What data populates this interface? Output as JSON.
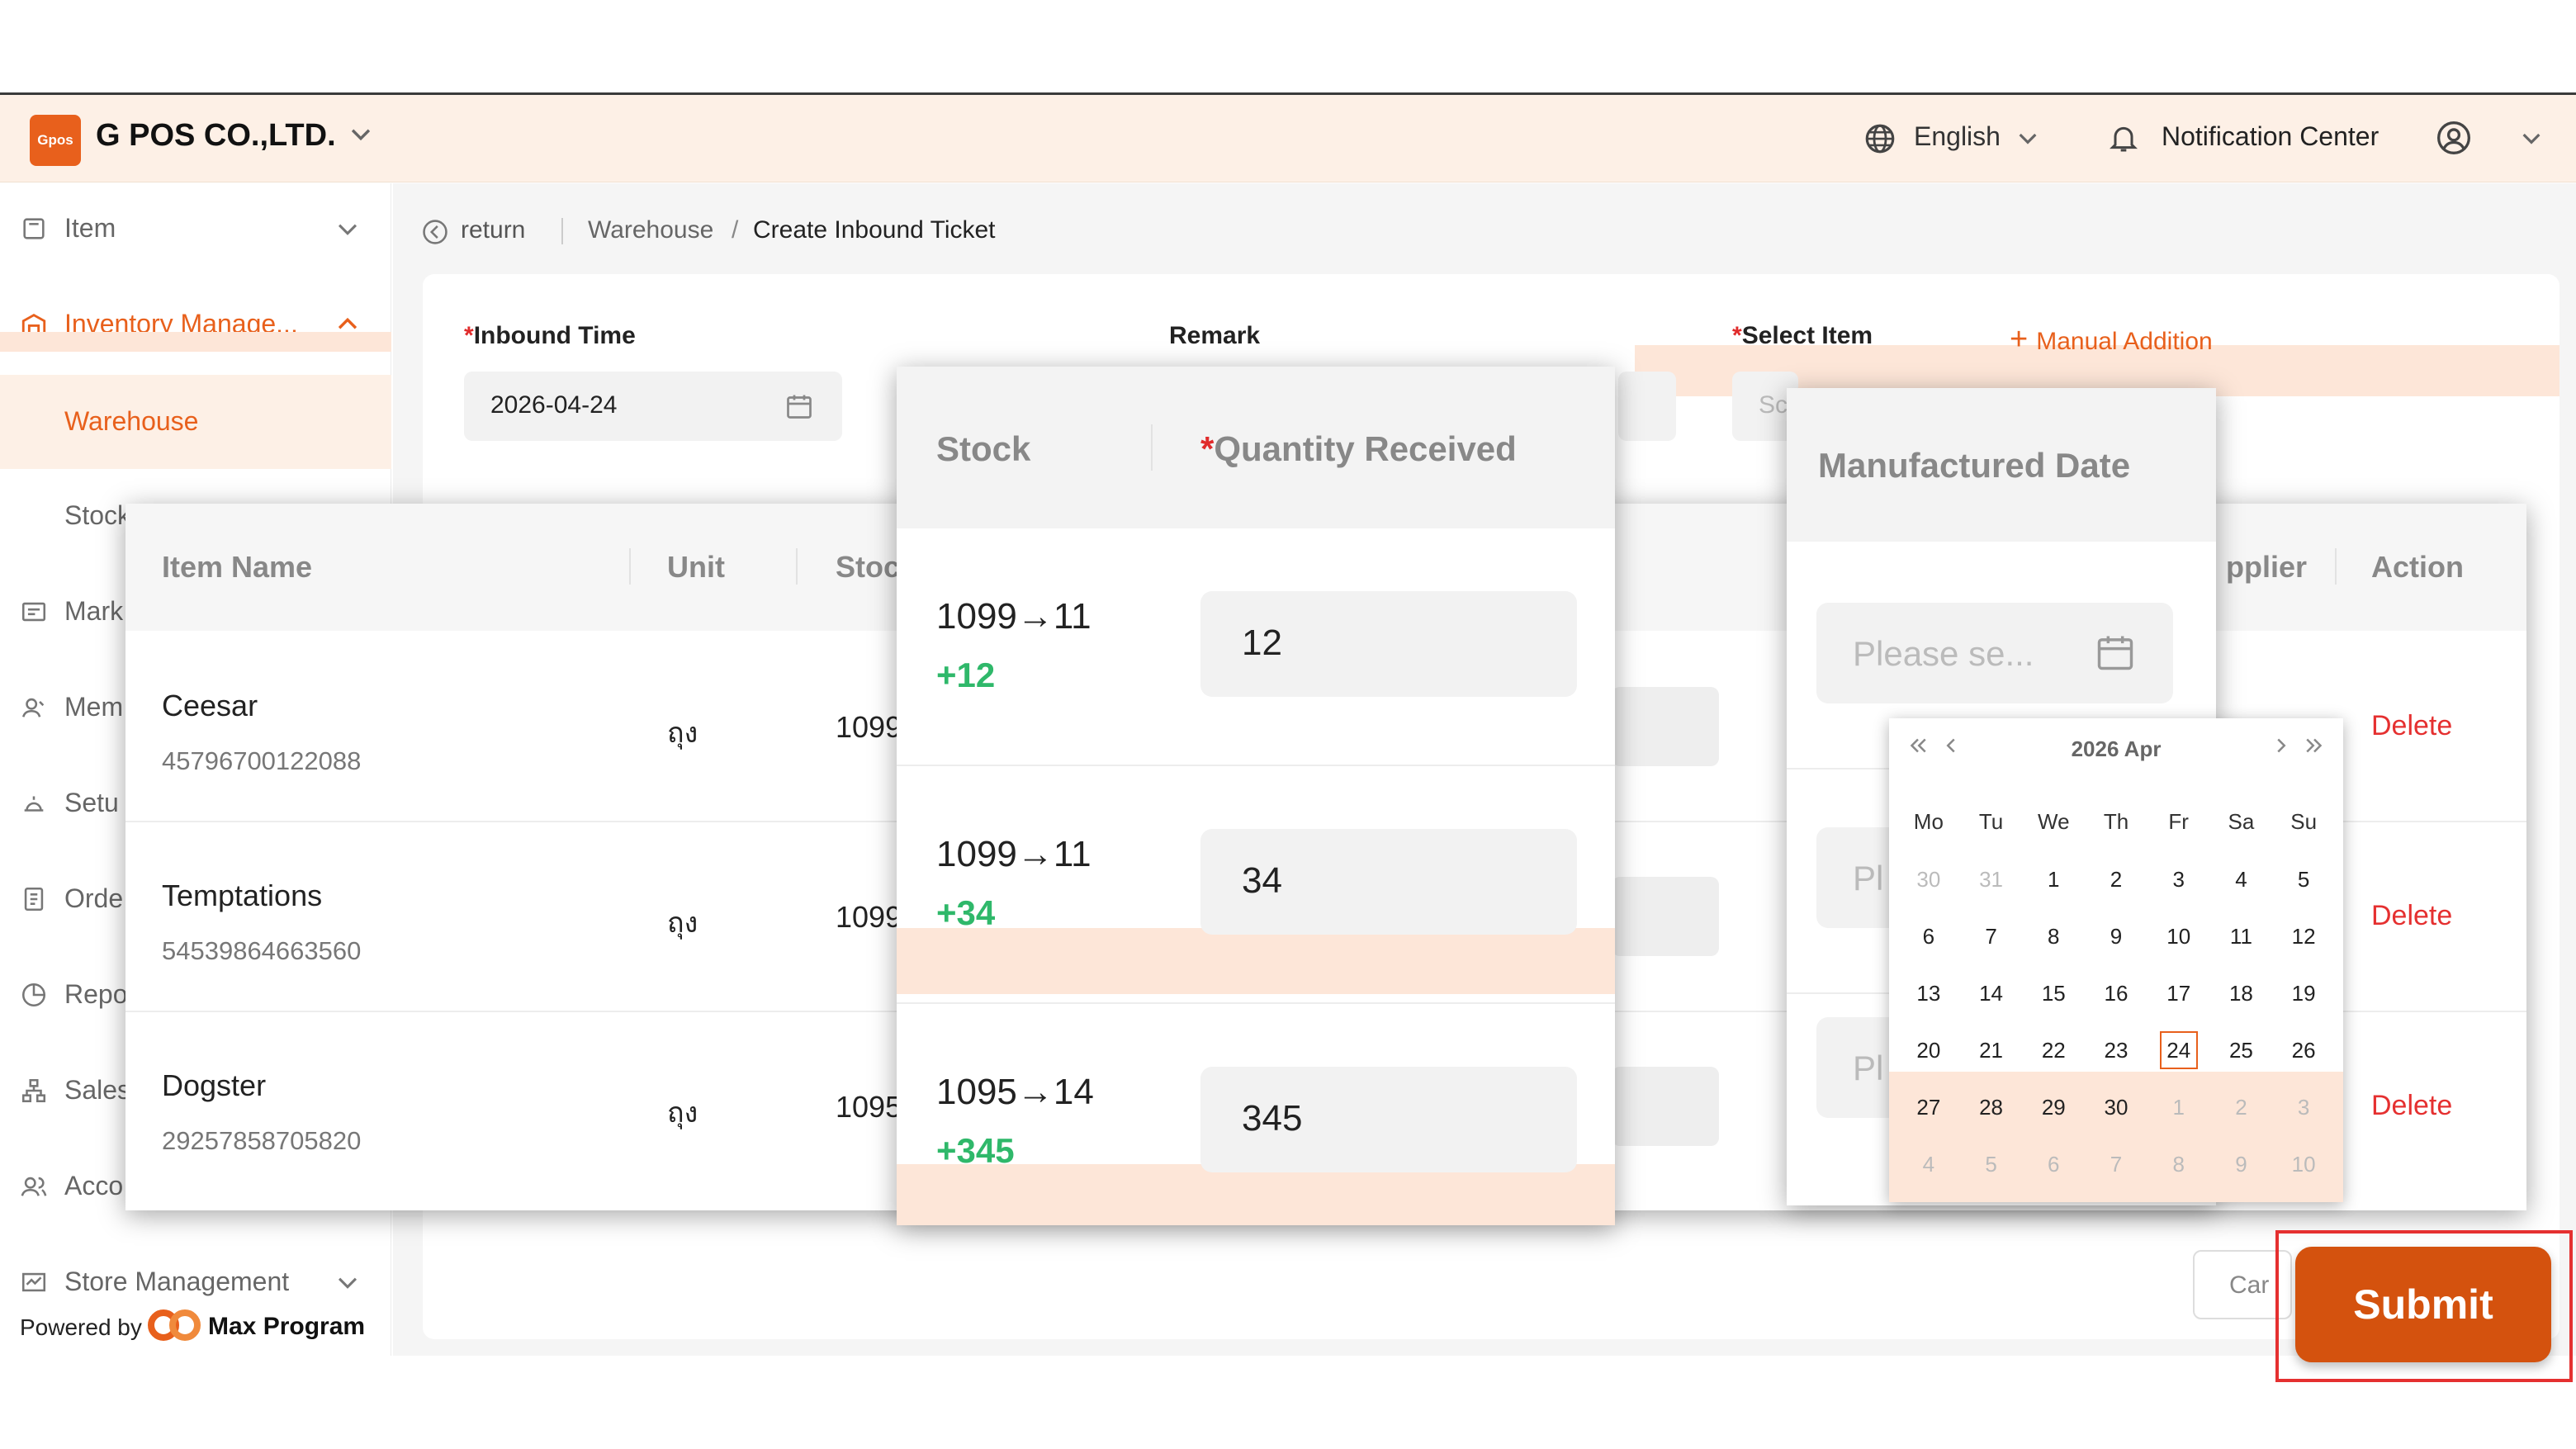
{
  "header": {
    "logo_text": "Gpos",
    "company": "G POS CO.,LTD.",
    "language": "English",
    "notification": "Notification Center"
  },
  "sidebar": {
    "items": [
      {
        "label": "Item"
      },
      {
        "label": "Inventory Manage..."
      },
      {
        "label": "Warehouse"
      },
      {
        "label": "Stock"
      },
      {
        "label": "Mark"
      },
      {
        "label": "Mem"
      },
      {
        "label": "Setu"
      },
      {
        "label": "Orde"
      },
      {
        "label": "Repo"
      },
      {
        "label": "Sales"
      },
      {
        "label": "Acco"
      },
      {
        "label": "Store Management"
      }
    ],
    "powered_by": "Powered by",
    "brand": "Max Program"
  },
  "breadcrumb": {
    "return": "return",
    "parent": "Warehouse",
    "separator": "/",
    "current": "Create Inbound Ticket"
  },
  "form": {
    "inbound_time_label": "Inbound Time",
    "inbound_time_value": "2026-04-24",
    "remark_label": "Remark",
    "select_item_label": "Select Item",
    "select_item_placeholder": "Sc",
    "manual_addition": "Manual Addition",
    "required_mark": "*"
  },
  "table": {
    "headers": [
      "Item Name",
      "Unit",
      "Stoc",
      "pplier",
      "Action"
    ],
    "rows": [
      {
        "name": "Ceesar",
        "code": "45796700122088",
        "unit": "ถุง",
        "stock": "1099",
        "action": "Delete"
      },
      {
        "name": "Temptations",
        "code": "54539864663560",
        "unit": "ถุง",
        "stock": "1099",
        "action": "Delete"
      },
      {
        "name": "Dogster",
        "code": "29257858705820",
        "unit": "ถุง",
        "stock": "1095",
        "action": "Delete"
      }
    ]
  },
  "stock_popup": {
    "header_stock": "Stock",
    "header_qty": "Quantity Received",
    "required_mark": "*",
    "rows": [
      {
        "stock": "1099→11",
        "plus": "+12",
        "qty": "12"
      },
      {
        "stock": "1099→11",
        "plus": "+34",
        "qty": "34"
      },
      {
        "stock": "1095→14",
        "plus": "+345",
        "qty": "345"
      }
    ]
  },
  "date_popup": {
    "header": "Manufactured Date",
    "placeholder": "Please se...",
    "placeholder_short": "Pl"
  },
  "calendar": {
    "title": "2026  Apr",
    "weekdays": [
      "Mo",
      "Tu",
      "We",
      "Th",
      "Fr",
      "Sa",
      "Su"
    ],
    "selected": "24",
    "weeks": [
      [
        [
          "30",
          "m"
        ],
        [
          "31",
          "m"
        ],
        [
          "1",
          ""
        ],
        [
          "2",
          ""
        ],
        [
          "3",
          ""
        ],
        [
          "4",
          ""
        ],
        [
          "5",
          ""
        ]
      ],
      [
        [
          "6",
          ""
        ],
        [
          "7",
          ""
        ],
        [
          "8",
          ""
        ],
        [
          "9",
          ""
        ],
        [
          "10",
          ""
        ],
        [
          "11",
          ""
        ],
        [
          "12",
          ""
        ]
      ],
      [
        [
          "13",
          ""
        ],
        [
          "14",
          ""
        ],
        [
          "15",
          ""
        ],
        [
          "16",
          ""
        ],
        [
          "17",
          ""
        ],
        [
          "18",
          ""
        ],
        [
          "19",
          ""
        ]
      ],
      [
        [
          "20",
          ""
        ],
        [
          "21",
          ""
        ],
        [
          "22",
          ""
        ],
        [
          "23",
          ""
        ],
        [
          "24",
          "s"
        ],
        [
          "25",
          ""
        ],
        [
          "26",
          ""
        ]
      ],
      [
        [
          "27",
          ""
        ],
        [
          "28",
          ""
        ],
        [
          "29",
          ""
        ],
        [
          "30",
          ""
        ],
        [
          "1",
          "m"
        ],
        [
          "2",
          "m"
        ],
        [
          "3",
          "m"
        ]
      ],
      [
        [
          "4",
          "m"
        ],
        [
          "5",
          "m"
        ],
        [
          "6",
          "m"
        ],
        [
          "7",
          "m"
        ],
        [
          "8",
          "m"
        ],
        [
          "9",
          "m"
        ],
        [
          "10",
          "m"
        ]
      ]
    ]
  },
  "footer": {
    "cancel": "Car",
    "submit": "Submit"
  },
  "colors": {
    "accent": "#e8601c",
    "submit": "#d4520e",
    "danger": "#e53030",
    "positive": "#2fb86a",
    "highlight": "#fde6d8"
  }
}
